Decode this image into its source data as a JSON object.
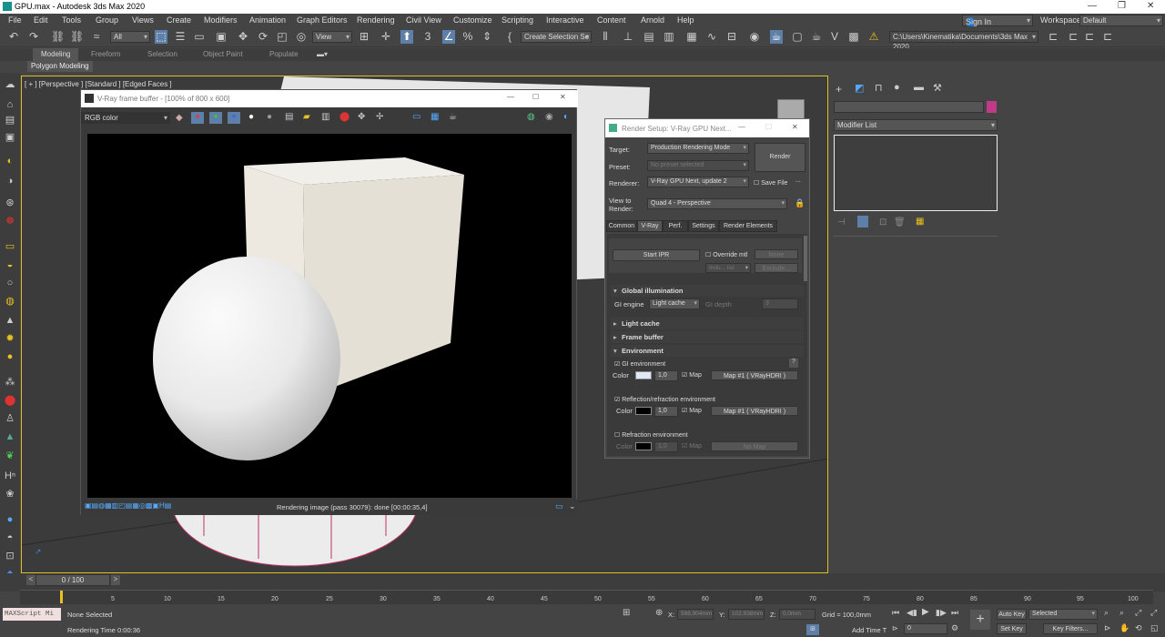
{
  "window": {
    "title": "GPU.max - Autodesk 3ds Max 2020"
  },
  "menu": [
    "File",
    "Edit",
    "Tools",
    "Group",
    "Views",
    "Create",
    "Modifiers",
    "Animation",
    "Graph Editors",
    "Rendering",
    "Civil View",
    "Customize",
    "Scripting",
    "Interactive",
    "Content",
    "Arnold",
    "Help"
  ],
  "account": {
    "sign_in": "Sign In",
    "workspaces_label": "Workspaces:",
    "workspace": "Default"
  },
  "toolbar": {
    "filter": "All",
    "view": "View",
    "selection_set": "Create Selection Se",
    "path": "C:\\Users\\Kinematika\\Documents\\3ds Max 2020"
  },
  "ribbon": {
    "tabs": [
      "Modeling",
      "Freeform",
      "Selection",
      "Object Paint",
      "Populate"
    ],
    "sub": "Polygon Modeling"
  },
  "viewport": {
    "label": "[ + ] [Perspective ] [Standard ] [Edged Faces ]"
  },
  "frame_buffer": {
    "title": "V-Ray frame buffer - [100% of 800 x 600]",
    "channel": "RGB color",
    "status": "Rendering image (pass 30079): done [00:00:35,4]"
  },
  "render_setup": {
    "title": "Render Setup: V-Ray GPU Next...",
    "target_label": "Target:",
    "target": "Production Rendering Mode",
    "preset_label": "Preset:",
    "preset": "No preset selected",
    "renderer_label": "Renderer:",
    "renderer": "V-Ray GPU Next, update 2",
    "save_file": "Save File",
    "view_label": "View to Render:",
    "view": "Quad 4 - Perspective",
    "render_button": "Render",
    "tabs": [
      "Common",
      "V-Ray",
      "Perf.",
      "Settings",
      "Render Elements"
    ],
    "start_ipr": "Start IPR",
    "override_mtl": "Override mtl",
    "none": "None",
    "indu": "Indu... list",
    "exclude": "Exclude...",
    "sections": [
      "Global illumination",
      "Light cache",
      "Frame buffer",
      "Environment"
    ],
    "gi_engine_label": "GI engine",
    "gi_engine": "Light cache",
    "gi_depth_label": "GI depth",
    "gi_depth": "3",
    "gi_env": "GI environment",
    "color_label": "Color",
    "mult": "1,0",
    "map_label": "Map",
    "map1": "Map #1  ( VRayHDRI )",
    "refl_env": "Reflection/refraction environment",
    "refr_env": "Refraction environment",
    "no_map": "No Map",
    "help": "?"
  },
  "right_panel": {
    "modifier_list": "Modifier List"
  },
  "timeline": {
    "frame": "0 / 100"
  },
  "ruler_ticks": [
    "5",
    "10",
    "15",
    "20",
    "25",
    "30",
    "35",
    "40",
    "45",
    "50",
    "55",
    "60",
    "65",
    "70",
    "75",
    "80",
    "85",
    "90",
    "95",
    "100"
  ],
  "status": {
    "script": "MAXScript Mi",
    "none_selected": "None Selected",
    "render_time": "Rendering Time  0:00:36",
    "x_label": "X:",
    "x": "598,904mm",
    "y_label": "Y:",
    "y": "102,938mm",
    "z_label": "Z:",
    "z": "0,0mm",
    "grid": "Grid = 100,0mm",
    "add_time": "Add Time T",
    "frame_field": "0",
    "auto_key": "Auto Key",
    "selected": "Selected",
    "set_key": "Set Key",
    "key_filters": "Key Filters..."
  }
}
